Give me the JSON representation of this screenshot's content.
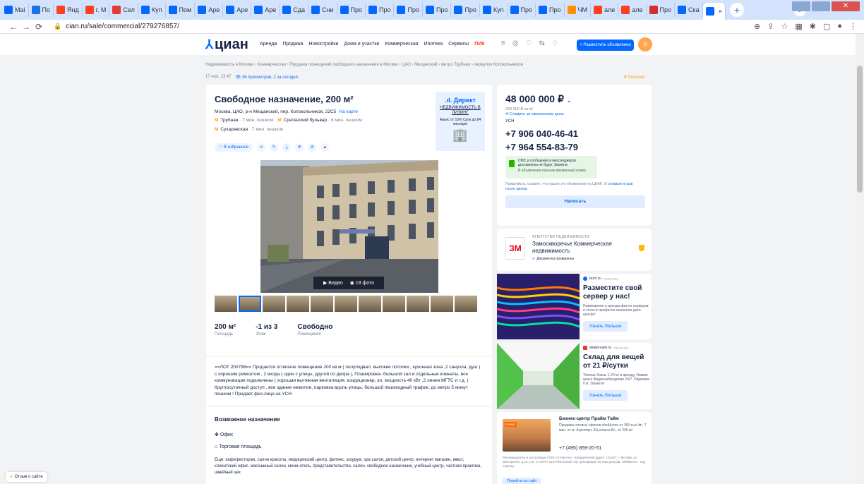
{
  "browser": {
    "tabs": [
      {
        "label": "Mai",
        "color": "#0468ff",
        "icon": "mail-icon"
      },
      {
        "label": "По",
        "color": "#1a73e8",
        "icon": "mail-icon"
      },
      {
        "label": "Янд",
        "color": "#fc3f1d",
        "icon": "yandex-icon"
      },
      {
        "label": "г. М",
        "color": "#fc3f1d",
        "icon": "yandex-icon"
      },
      {
        "label": "Сел",
        "color": "#e53935",
        "icon": "map-pin-icon"
      },
      {
        "label": "Куп",
        "color": "#0468ff",
        "icon": "cian-icon"
      },
      {
        "label": "Пом",
        "color": "#0468ff",
        "icon": "cian-icon"
      },
      {
        "label": "Аре",
        "color": "#0468ff",
        "icon": "cian-icon"
      },
      {
        "label": "Аре",
        "color": "#0468ff",
        "icon": "cian-icon"
      },
      {
        "label": "Аре",
        "color": "#0468ff",
        "icon": "cian-icon"
      },
      {
        "label": "Сда",
        "color": "#0468ff",
        "icon": "cian-icon"
      },
      {
        "label": "Сни",
        "color": "#0468ff",
        "icon": "cian-icon"
      },
      {
        "label": "Про",
        "color": "#0468ff",
        "icon": "cian-icon"
      },
      {
        "label": "Про",
        "color": "#0468ff",
        "icon": "cian-icon"
      },
      {
        "label": "Про",
        "color": "#0468ff",
        "icon": "cian-icon"
      },
      {
        "label": "Про",
        "color": "#0468ff",
        "icon": "cian-icon"
      },
      {
        "label": "Про",
        "color": "#0468ff",
        "icon": "cian-icon"
      },
      {
        "label": "Куп",
        "color": "#0468ff",
        "icon": "cian-icon"
      },
      {
        "label": "Про",
        "color": "#0468ff",
        "icon": "cian-icon"
      },
      {
        "label": "Про",
        "color": "#0468ff",
        "icon": "cian-icon"
      },
      {
        "label": "ЧМ",
        "color": "#ff8f00",
        "icon": "bookmark-icon"
      },
      {
        "label": "але",
        "color": "#fc3f1d",
        "icon": "yandex-icon"
      },
      {
        "label": "але",
        "color": "#fc3f1d",
        "icon": "yandex-icon"
      },
      {
        "label": "Про",
        "color": "#d32f2f",
        "icon": "red-pin-icon"
      },
      {
        "label": "Ска",
        "color": "#0468ff",
        "icon": "download-icon"
      },
      {
        "label": "",
        "color": "#0468ff",
        "icon": "cian-icon",
        "active": true
      }
    ],
    "active_tab_close": "×",
    "new_tab": "+",
    "url": "cian.ru/sale/commercial/279276857/"
  },
  "site": {
    "logo": "циан",
    "menu": [
      "Аренда",
      "Продажа",
      "Новостройки",
      "Дома и участки",
      "Коммерческая",
      "Ипотека",
      "Сервисы"
    ],
    "menu_pik": "ПИК",
    "post_button": "+ Разместить объявление",
    "avatar_letter": "9",
    "accent": "#0468ff"
  },
  "breadcrumbs": "Недвижимость в Москве  ›  Коммерческая  ›  Продажа помещений свободного назначения в Москве  ›  ЦАО  ›  Мещанский  ›  метро Трубная  ›  переулок Колокольников",
  "meta": {
    "date": "17 ноя, 13:47",
    "views": "36 просмотров, 2 за сегодня",
    "paid": "Платное"
  },
  "listing": {
    "title": "Свободное назначение, 200 м²",
    "address": "Москва, ЦАО, р-н Мещанский, пер. Колокольников, 22С5",
    "on_map": "На карте",
    "metro": [
      {
        "name": "Трубная",
        "walk": "· 7 мин. пешком"
      },
      {
        "name": "Сретенский бульвар",
        "walk": "· 8 мин. пешком"
      },
      {
        "name": "Сухаревская",
        "walk": "· 7 мин. пешком"
      }
    ],
    "favorite": "♡ В избранное",
    "direct": {
      "brand": ".ıl. Директ",
      "line1": "НЕДВИЖИМОСТЬ В ЛИЗИНГ",
      "line2": "Аванс от 15% Срок до 84 месяцев"
    },
    "media": {
      "video": "Видео",
      "photos": "18 фото"
    },
    "stats": [
      {
        "value": "200 м²",
        "label": "Площадь"
      },
      {
        "value": "-1 из 3",
        "label": "Этаж"
      },
      {
        "value": "Свободно",
        "label": "Помещение"
      }
    ],
    "description": "==ЛОТ 200798== Продается отличное помещение 200 кв.м ( полуподвал, высокие потолки , кухонная зона ,2 санузла, душ ) с хорошим ремонтом , 2 входа ( один с улицы, другой со двора ), Планировка- большой зал и отдельные комнаты, все коммуникации подключены ( хорошая вытяжная вентиляция, кондиционер, эл. мощность 40 кВт ,2 линии МГТС и т.д. ) Круглосуточный доступ , все здание нежилое, парковка вдоль улицы, большой пешеходный трафик, до метро 5 минут пешком ! Продает физ.лицо на УСН.",
    "purpose_heading": "Возможное назначение",
    "purposes": [
      "Офис",
      "Торговая площадь"
    ],
    "purposes_more": "Еще: кафе/ресторан, салон красоты, медицинский центр, фитнес, шоурум, spa салон, детский центр, интернет магазин, квест, клиентский офис, массажный салон, мини-отель, представительство, салон, свободное назначение, учебный центр, частная практика, швейный цех"
  },
  "price": {
    "value": "48 000 000 ₽",
    "per_m2": "240 000 ₽ за м²",
    "watch": "Следить за изменением цены",
    "tax": "УСН",
    "phone1": "+7 906 040-46-41",
    "phone2": "+7 964 554-83-79",
    "sms_title": "СМС и сообщения в мессенджерах доставлены не будут. Звоните",
    "sms_sub": "В объявлении показан временный номер",
    "note": "Пожалуйста, скажите, что нашли это объявление на ЦИАН. И",
    "note_link": "оставьте отзыв после звонка",
    "write": "Написать"
  },
  "agency": {
    "logo": "ЗМ",
    "type": "АГЕНТСТВО НЕДВИЖИМОСТИ",
    "name": "Замоскворечье Коммерческая недвижимость",
    "verified": "Документы проверены"
  },
  "ads": [
    {
      "source": "tech.ru",
      "ad_label": "РЕКЛАМА",
      "heading": "Разместите свой сервер у нас!",
      "body": "Размещение и аренда физ-их серверов и стоек в професси-ональном дата-центре!",
      "button": "Узнать больше"
    },
    {
      "source": "sklad-vam.ru",
      "ad_label": "РЕКЛАМА",
      "heading": "Склад для вещей от 21 ₽/сутки",
      "body": "Тёплые боксы 1-20 м² в аренду. Низкие цены! Видеонаблюдение 24/7. Парковка 0 ₽. Звоните!",
      "button": "Узнать больше"
    }
  ],
  "bc": {
    "badge": "PRIME",
    "title": "Бизнес-центр Прайм Тайм",
    "desc": "Продажа готовых офисов shell&core от 300 тыс./м², 7 мин. от м. Аэропорт. БЦ класса В+, от 265 м²",
    "phone": "+7 (495) 859-20-51",
    "fine": "Рекламодатель и застройщик ООО «Атлантик». Юридический адрес: 125167, г. Москва, ул. Викторенко, д.16, стр. 3. ОГРН 1137746713948. Пр. декларация на наш.дом.рф. Shell&core - под отделку",
    "button": "Перейти на сайт"
  },
  "feedback": "Отзыв о сайте"
}
